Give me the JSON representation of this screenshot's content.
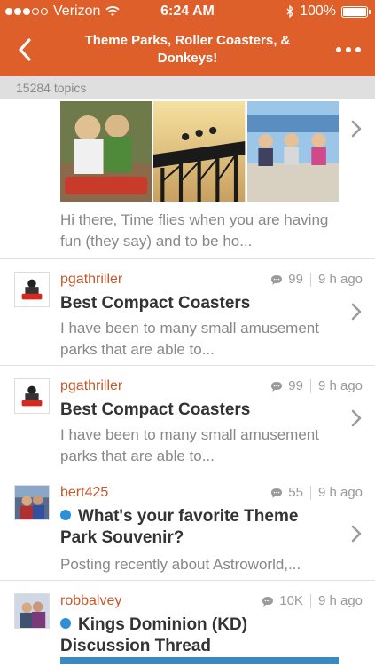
{
  "status_bar": {
    "carrier": "Verizon",
    "time": "6:24 AM",
    "battery": "100%"
  },
  "nav": {
    "title": "Theme Parks, Roller Coasters, & Donkeys!",
    "back_icon": "chevron-left-icon",
    "more_icon": "more-dots-icon"
  },
  "topic_count": "15284 topics",
  "featured": {
    "excerpt": "Hi there, Time flies when you are having fun (they say) and to be ho..."
  },
  "posts": [
    {
      "author": "pgathriller",
      "replies": "99",
      "time": "9 h ago",
      "title": "Best Compact Coasters",
      "excerpt": "I have been to many small amusement parks that are able to...",
      "unread": false
    },
    {
      "author": "pgathriller",
      "replies": "99",
      "time": "9 h ago",
      "title": "Best Compact Coasters",
      "excerpt": "I have been to many small amusement parks that are able to...",
      "unread": false
    },
    {
      "author": "bert425",
      "replies": "55",
      "time": "9 h ago",
      "title": "What's your favorite Theme Park Souvenir?",
      "excerpt": "Posting recently about Astroworld,...",
      "unread": true
    },
    {
      "author": "robbalvey",
      "replies": "10K",
      "time": "9 h ago",
      "title": "Kings Dominion (KD) Discussion Thread",
      "excerpt": "",
      "unread": true
    }
  ],
  "colors": {
    "accent": "#df5f2b",
    "author": "#c8572a",
    "unread_dot": "#2f8fd6"
  }
}
